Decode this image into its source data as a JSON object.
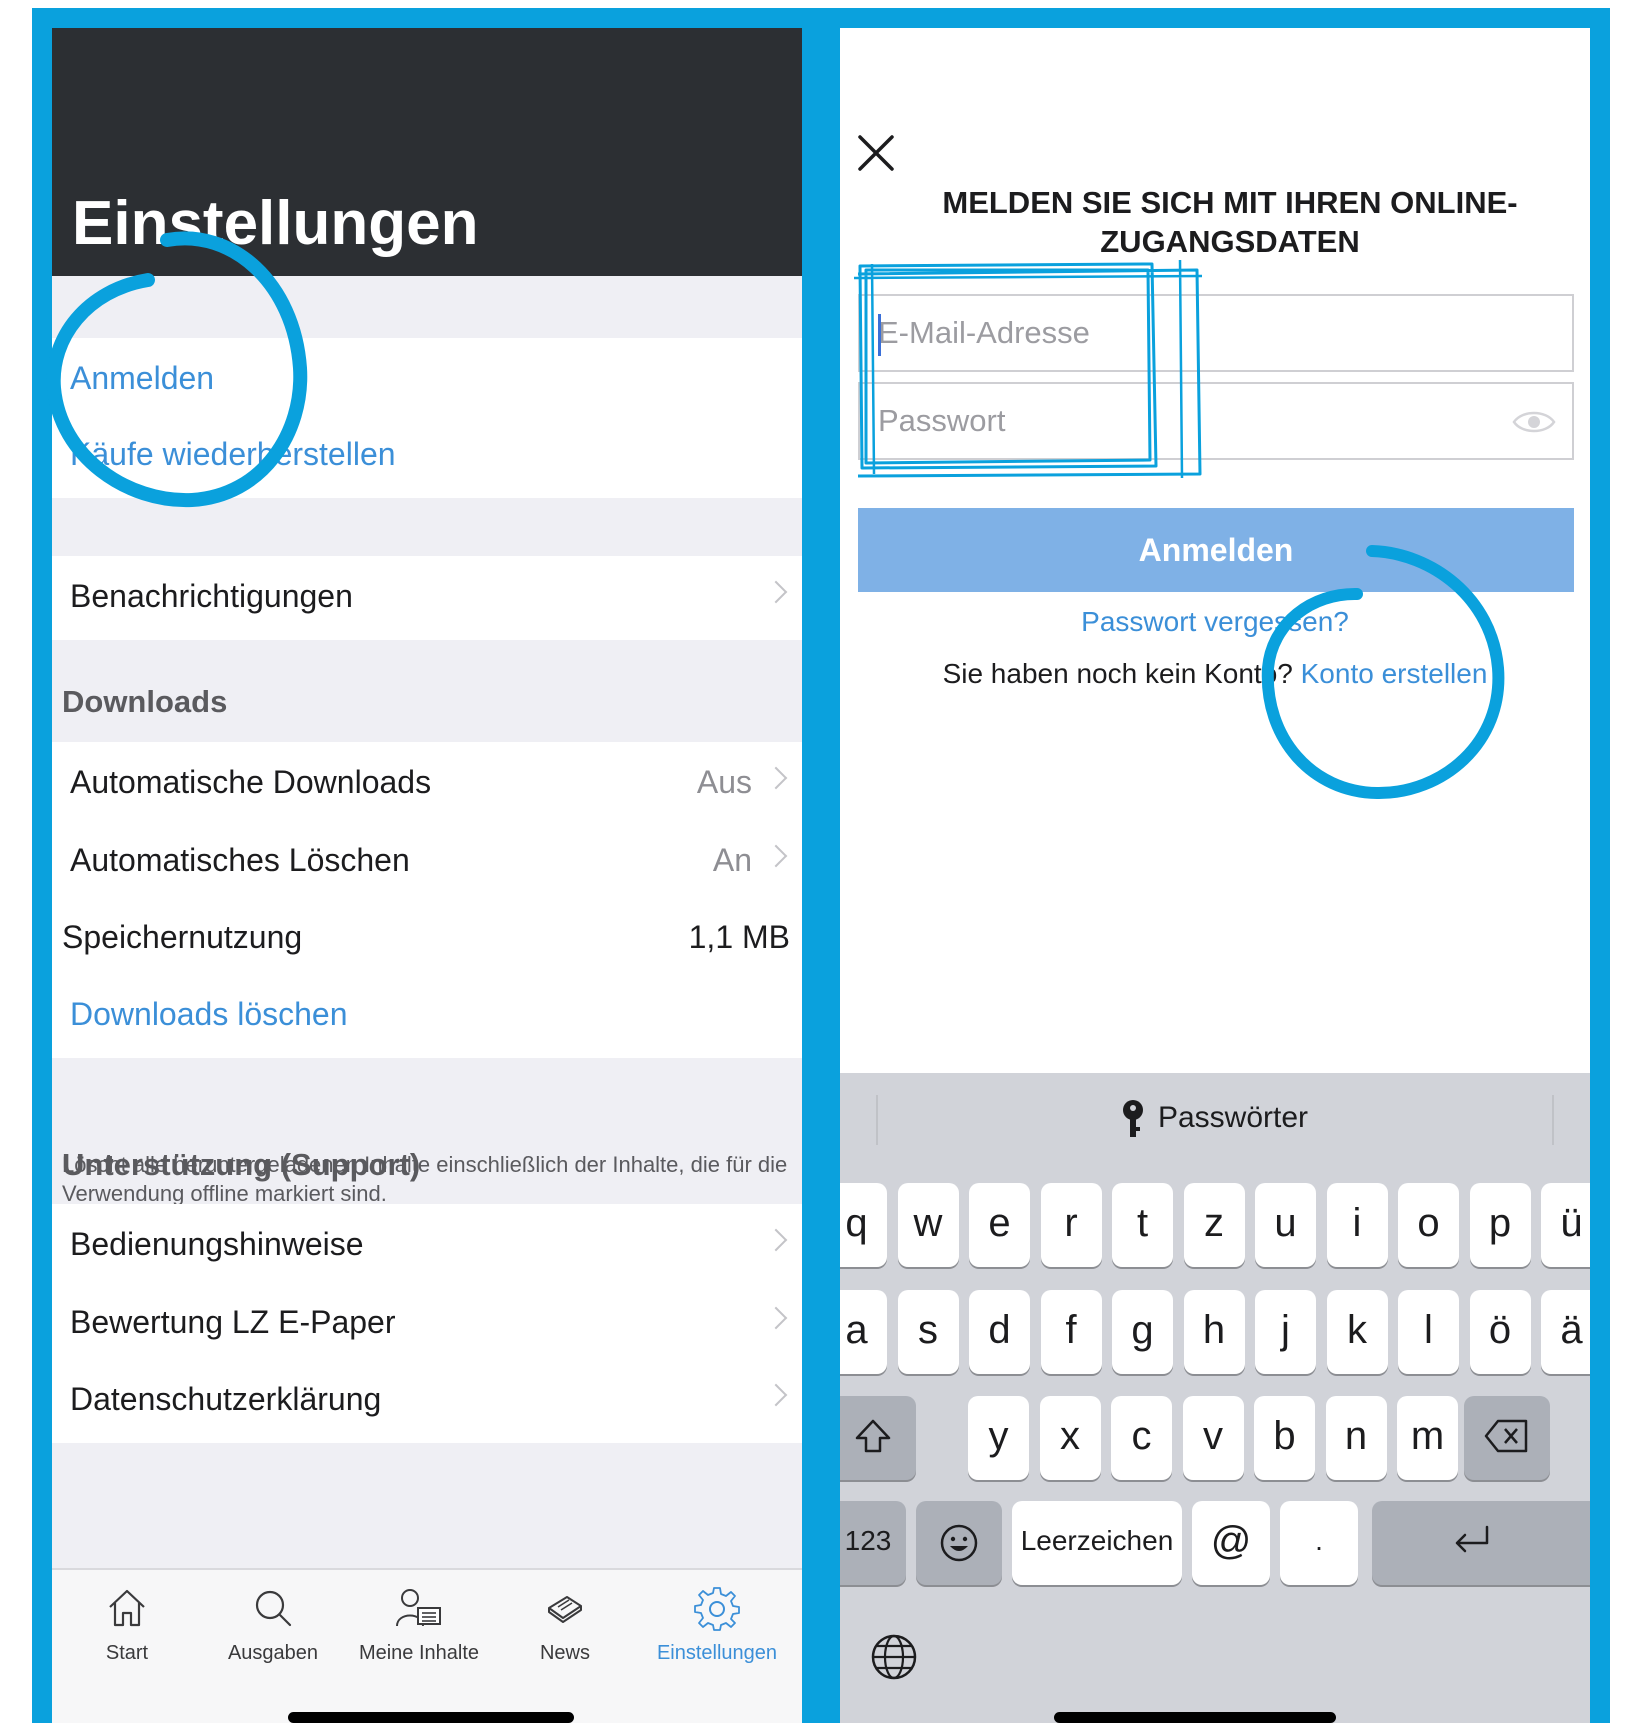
{
  "left": {
    "title": "Einstellungen",
    "account_items": [
      "Anmelden",
      "Käufe wiederherstellen"
    ],
    "notifications": "Benachrichtigungen",
    "downloads_header": "Downloads",
    "downloads": [
      {
        "label": "Automatische Downloads",
        "value": "Aus"
      },
      {
        "label": "Automatisches Löschen",
        "value": "An"
      },
      {
        "label": "Speichernutzung",
        "value": "1,1 MB"
      }
    ],
    "clear_downloads": "Downloads löschen",
    "clear_note": "Löscht alle heruntergeladenen Inhalte einschließlich der Inhalte, die für die Verwendung offline markiert sind.",
    "support_header": "Unterstützung (Support)",
    "support_items": [
      "Bedienungshinweise",
      "Bewertung LZ E-Paper",
      "Datenschutzerklärung"
    ],
    "tabs": [
      {
        "label": "Start",
        "icon": "home-icon"
      },
      {
        "label": "Ausgaben",
        "icon": "search-icon"
      },
      {
        "label": "Meine Inhalte",
        "icon": "person-newspaper-icon"
      },
      {
        "label": "News",
        "icon": "newspaper-icon"
      },
      {
        "label": "Einstellungen",
        "icon": "gear-icon",
        "active": true
      }
    ]
  },
  "right": {
    "title": "MELDEN SIE SICH MIT IHREN ONLINE-ZUGANGSDATEN",
    "email_placeholder": "E-Mail-Adresse",
    "password_placeholder": "Passwort",
    "login_button": "Anmelden",
    "forgot": "Passwort vergessen?",
    "no_account": "Sie haben noch kein Konto?",
    "create_account": "Konto erstellen",
    "keyboard": {
      "suggestion": "Passwörter",
      "row1": [
        "q",
        "w",
        "e",
        "r",
        "t",
        "z",
        "u",
        "i",
        "o",
        "p",
        "ü"
      ],
      "row2": [
        "a",
        "s",
        "d",
        "f",
        "g",
        "h",
        "j",
        "k",
        "l",
        "ö",
        "ä"
      ],
      "row3": [
        "y",
        "x",
        "c",
        "v",
        "b",
        "n",
        "m"
      ],
      "numbers": "123",
      "space": "Leerzeichen",
      "at": "@",
      "dot": "."
    }
  },
  "colors": {
    "frame": "#0aa1dd",
    "link_blue": "#3b8fd8",
    "header_dark": "#2c2f33",
    "button_blue": "#7fb1e6"
  }
}
